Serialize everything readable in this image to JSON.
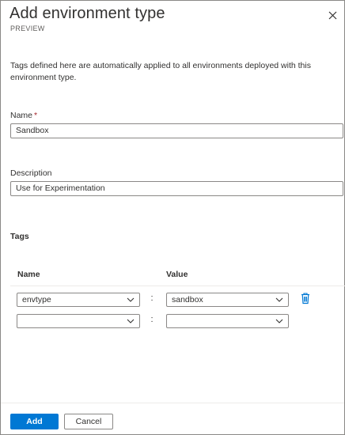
{
  "panel": {
    "title": "Add environment type",
    "subtitle": "PREVIEW",
    "close_icon": "close-icon",
    "description": "Tags defined here are automatically applied to all environments deployed with this environment type."
  },
  "form": {
    "name_label": "Name",
    "name_required_marker": "*",
    "name_value": "Sandbox",
    "description_label": "Description",
    "description_value": "Use for Experimentation"
  },
  "tags": {
    "section_title": "Tags",
    "col_name": "Name",
    "col_value": "Value",
    "separator": ":",
    "rows": [
      {
        "name": "envtype",
        "value": "sandbox",
        "delete_icon": "trash-icon"
      },
      {
        "name": "",
        "value": ""
      }
    ]
  },
  "footer": {
    "add_label": "Add",
    "cancel_label": "Cancel"
  },
  "colors": {
    "primary": "#0078d4",
    "required": "#a4262c",
    "border": "#8a8886"
  }
}
